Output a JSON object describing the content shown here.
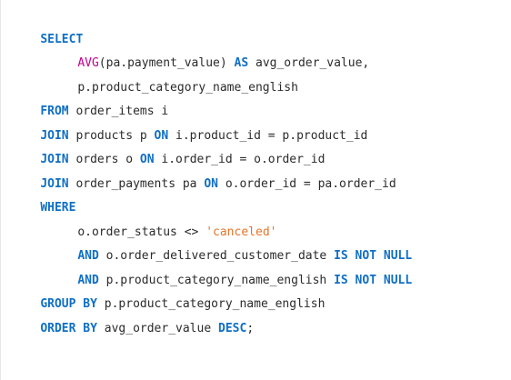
{
  "editor": {
    "lines": [
      [
        {
          "t": "SELECT",
          "c": "kw"
        }
      ],
      [
        {
          "t": "AVG",
          "c": "fn"
        },
        {
          "t": "(pa.payment_value) ",
          "c": ""
        },
        {
          "t": "AS",
          "c": "kw"
        },
        {
          "t": " avg_order_value,",
          "c": ""
        }
      ],
      [
        {
          "t": "p.product_category_name_english",
          "c": ""
        }
      ],
      [
        {
          "t": "FROM",
          "c": "kw"
        },
        {
          "t": " order_items i",
          "c": ""
        }
      ],
      [
        {
          "t": "JOIN",
          "c": "kw"
        },
        {
          "t": " products p ",
          "c": ""
        },
        {
          "t": "ON",
          "c": "kw"
        },
        {
          "t": " i.product_id = p.product_id",
          "c": ""
        }
      ],
      [
        {
          "t": "JOIN",
          "c": "kw"
        },
        {
          "t": " orders o ",
          "c": ""
        },
        {
          "t": "ON",
          "c": "kw"
        },
        {
          "t": " i.order_id = o.order_id",
          "c": ""
        }
      ],
      [
        {
          "t": "JOIN",
          "c": "kw"
        },
        {
          "t": " order_payments pa ",
          "c": ""
        },
        {
          "t": "ON",
          "c": "kw"
        },
        {
          "t": " o.order_id = pa.order_id",
          "c": ""
        }
      ],
      [
        {
          "t": "WHERE",
          "c": "kw"
        }
      ],
      [
        {
          "t": "o.order_status <> ",
          "c": ""
        },
        {
          "t": "'canceled'",
          "c": "str"
        }
      ],
      [
        {
          "t": "AND",
          "c": "kw"
        },
        {
          "t": " o.order_delivered_customer_date ",
          "c": ""
        },
        {
          "t": "IS NOT NULL",
          "c": "kw"
        }
      ],
      [
        {
          "t": "AND",
          "c": "kw"
        },
        {
          "t": " p.product_category_name_english ",
          "c": ""
        },
        {
          "t": "IS NOT NULL",
          "c": "kw"
        }
      ],
      [
        {
          "t": "GROUP BY",
          "c": "kw"
        },
        {
          "t": " p.product_category_name_english",
          "c": ""
        }
      ],
      [
        {
          "t": "ORDER BY",
          "c": "kw"
        },
        {
          "t": " avg_order_value ",
          "c": ""
        },
        {
          "t": "DESC",
          "c": "kw"
        },
        {
          "t": ";",
          "c": ""
        }
      ]
    ]
  },
  "colors": {
    "keyword": "#0f6fc5",
    "function": "#c1008f",
    "string": "#e5742a",
    "text": "#2b2b2b",
    "background": "#ffffff"
  }
}
